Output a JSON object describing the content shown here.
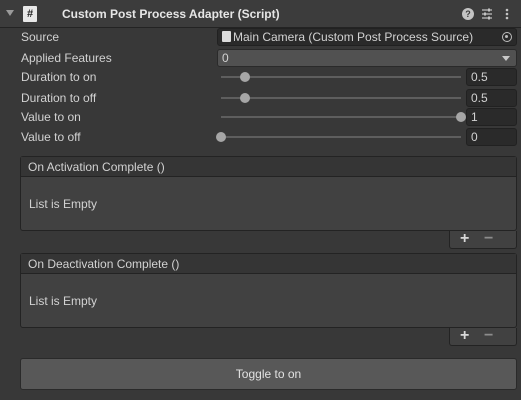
{
  "header": {
    "title": "Custom Post Process Adapter (Script)",
    "script_icon_glyph": "#",
    "help_glyph": "?"
  },
  "fields": {
    "source": {
      "label": "Source",
      "value": "Main Camera (Custom Post Process Source)"
    },
    "applied_features": {
      "label": "Applied Features",
      "value": "0"
    },
    "duration_to_on": {
      "label": "Duration to on",
      "value": "0.5",
      "slider_fraction": 0.1
    },
    "duration_to_off": {
      "label": "Duration to off",
      "value": "0.5",
      "slider_fraction": 0.1
    },
    "value_to_on": {
      "label": "Value to on",
      "value": "1",
      "slider_fraction": 1.0
    },
    "value_to_off": {
      "label": "Value to off",
      "value": "0",
      "slider_fraction": 0.0
    }
  },
  "events": [
    {
      "title": "On Activation Complete ()",
      "empty_text": "List is Empty",
      "add_label": "+",
      "remove_label": "−"
    },
    {
      "title": "On Deactivation Complete ()",
      "empty_text": "List is Empty",
      "add_label": "+",
      "remove_label": "−"
    }
  ],
  "toggle_button": {
    "label": "Toggle to on"
  },
  "icons": {
    "foldout": "chevron-down-icon",
    "script": "script-icon",
    "help": "help-icon",
    "presets": "sliders-icon",
    "menu": "kebab-menu-icon",
    "object": "camera-object-icon",
    "picker": "object-picker-icon",
    "dropdown": "chevron-down-icon"
  }
}
